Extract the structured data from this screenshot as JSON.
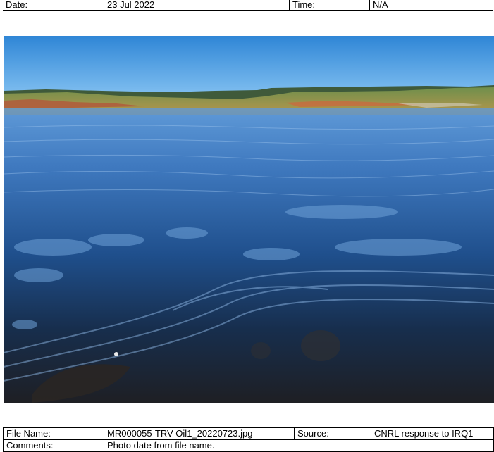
{
  "header": {
    "date_label": "Date:",
    "date_value": "23 Jul 2022",
    "time_label": "Time:",
    "time_value": "N/A"
  },
  "photo": {
    "subject": "lake-oil-sheen-photo"
  },
  "footer": {
    "file_name_label": "File Name:",
    "file_name_value": "MR000055-TRV Oil1_20220723.jpg",
    "source_label": "Source:",
    "source_value": "CNRL response to IRQ1",
    "comments_label": "Comments:",
    "comments_value": "Photo date from file name."
  }
}
